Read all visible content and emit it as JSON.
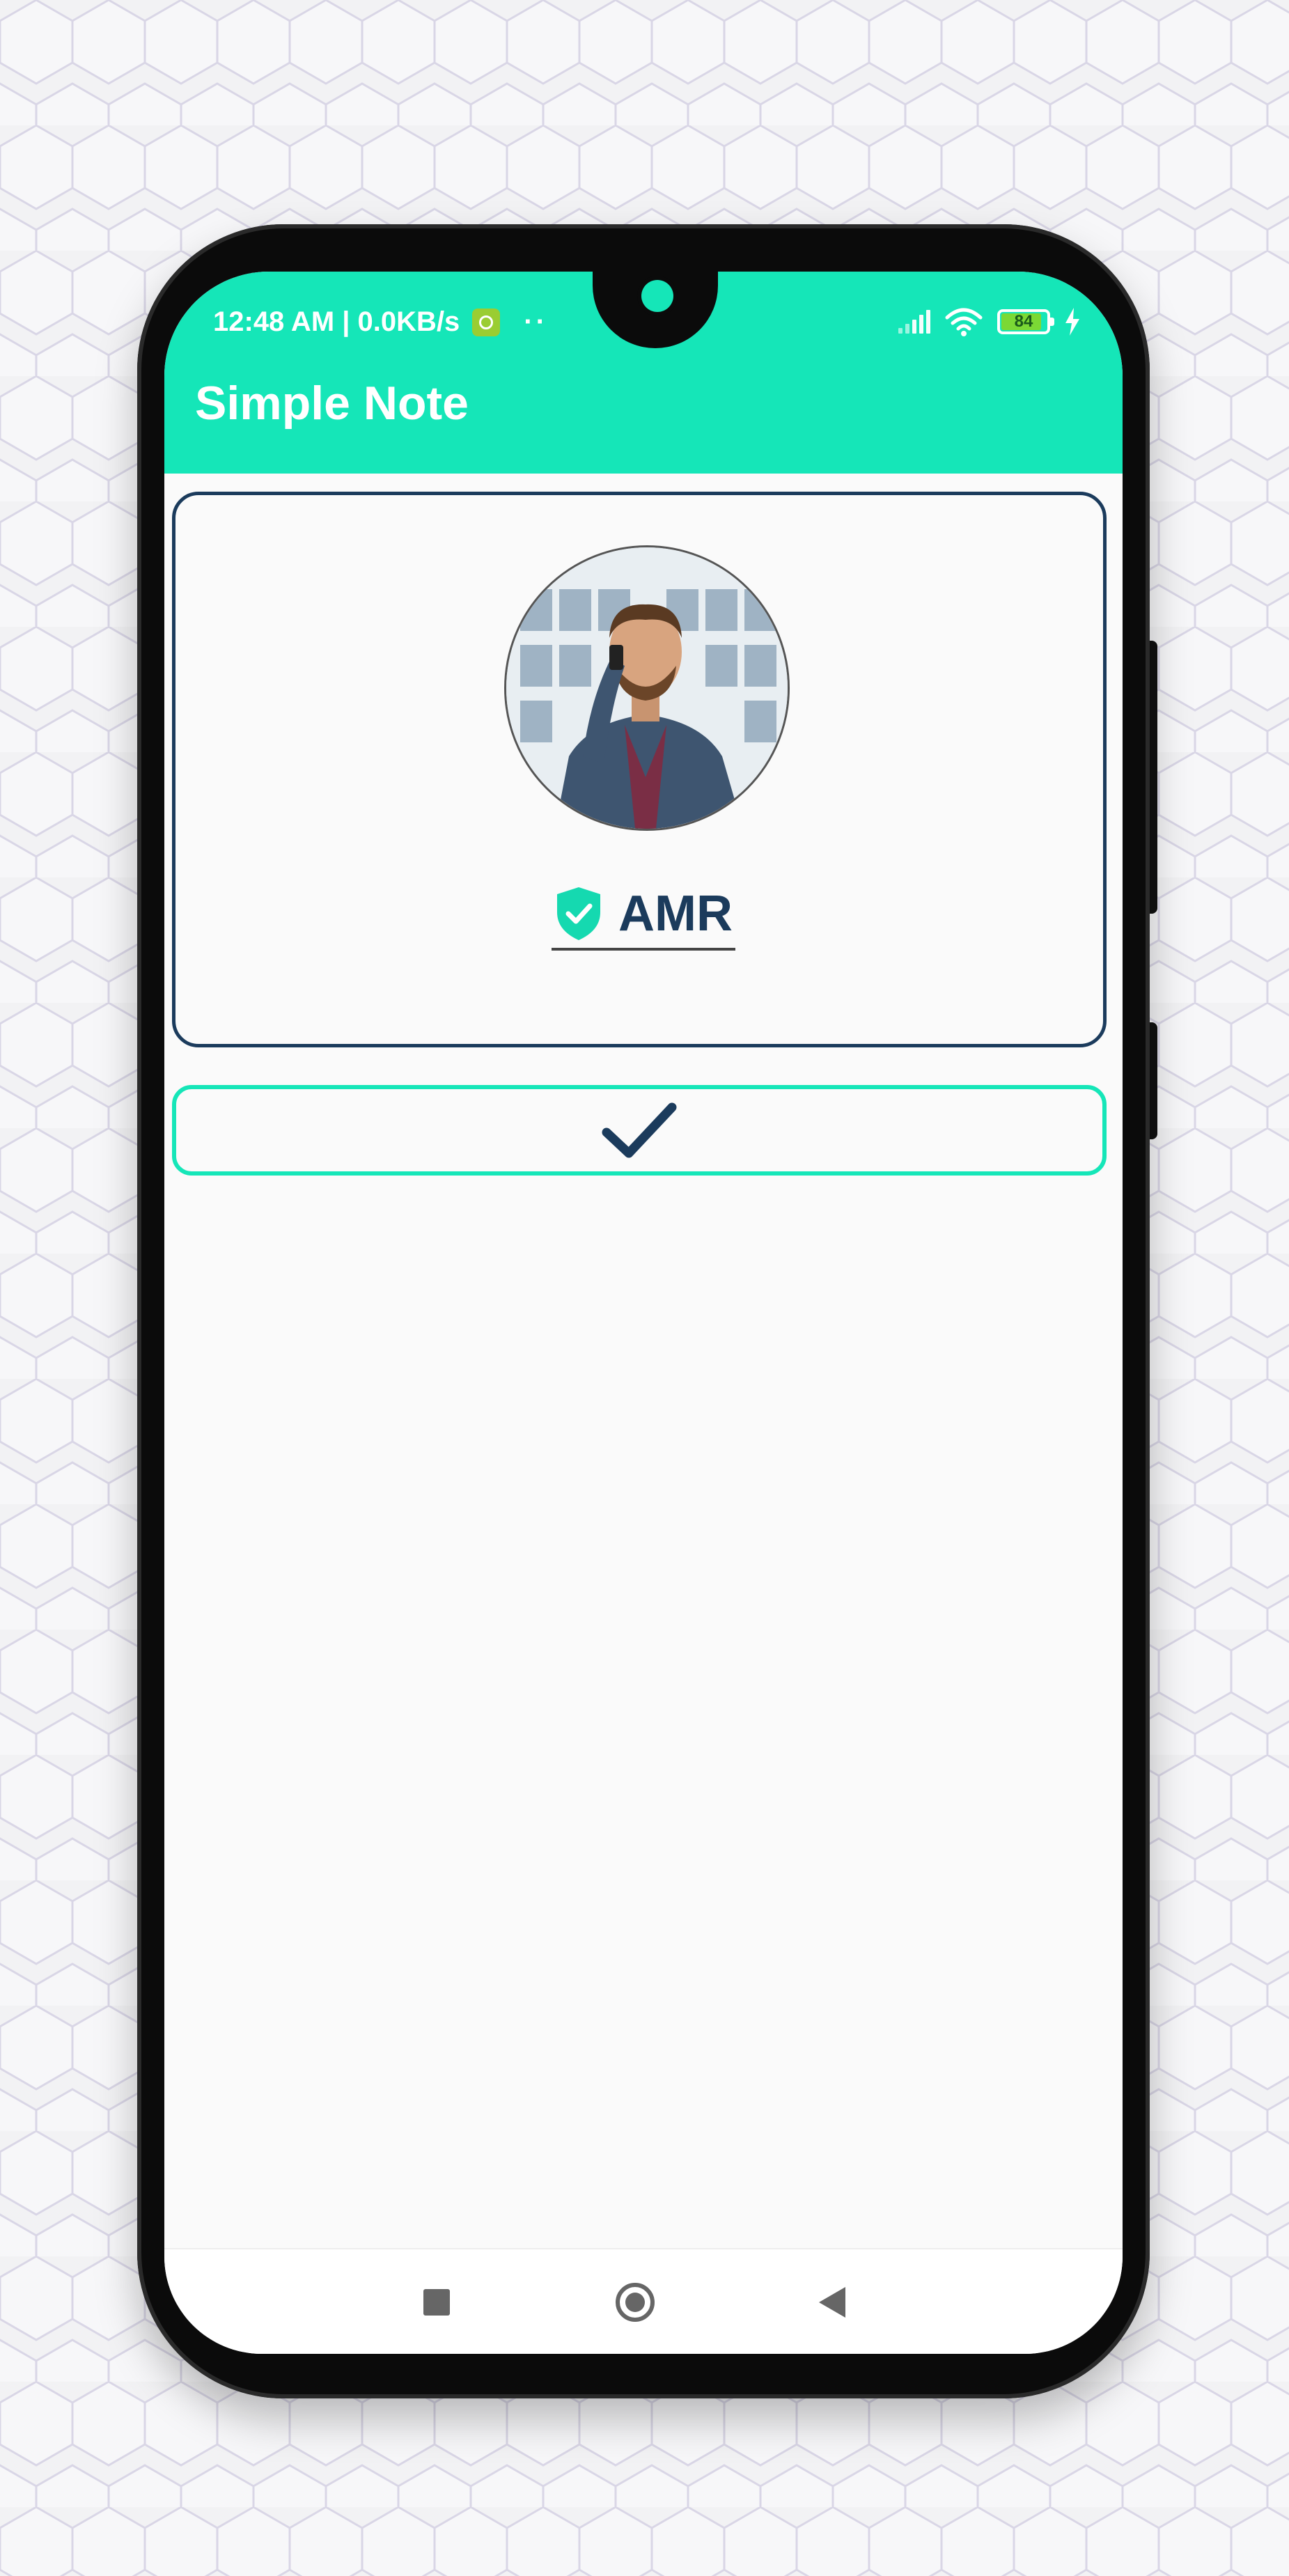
{
  "status_bar": {
    "time_network": "12:48 AM | 0.0KB/s",
    "dots": "··",
    "battery_level": "84"
  },
  "app_bar": {
    "title": "Simple Note"
  },
  "profile": {
    "name": "AMR",
    "verified_icon": "shield-check-icon",
    "avatar_icon": "person-photo"
  },
  "confirm": {
    "icon": "checkmark-icon"
  },
  "nav": {
    "recents_icon": "square-icon",
    "home_icon": "circle-icon",
    "back_icon": "triangle-back-icon"
  },
  "colors": {
    "accent": "#15e6b8",
    "dark_blue": "#1b3b5c",
    "background": "#fafafa"
  }
}
